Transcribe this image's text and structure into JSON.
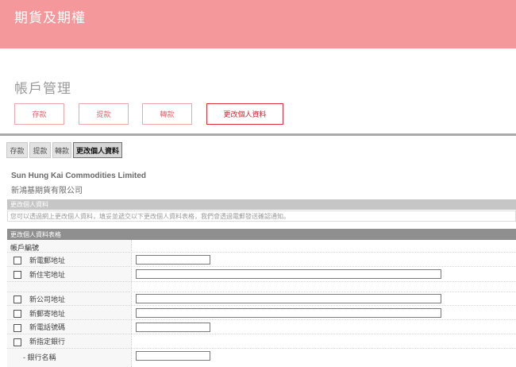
{
  "header": {
    "title": "期貨及期權"
  },
  "section": {
    "title": "帳戶管理"
  },
  "actions": {
    "deposit": "存款",
    "withdraw": "提款",
    "transfer": "轉款",
    "update_info": "更改個人資料"
  },
  "tabs": [
    "存款",
    "提款",
    "轉款",
    "更改個人資料"
  ],
  "company": {
    "name_en": "Sun Hung Kai Commodities Limited",
    "name_zh": "新鴻基期貨有限公司"
  },
  "info_band": {
    "title": "更改個人資料",
    "note": "您可以透過網上更改個人資料，填妥並遞交以下更改個人資料表格，我們會透過電郵發送確認通知。"
  },
  "form": {
    "title": "更改個人資料表格",
    "account_label": "帳戶編號",
    "fields": {
      "email": "新電郵地址",
      "home_address": "新住宅地址",
      "office_address": "新公司地址",
      "mailing_address": "新郵寄地址",
      "phone": "新電話號碼",
      "bank": "新指定銀行",
      "bank_name": "- 銀行名稱"
    }
  },
  "colors": {
    "header_bg": "#f4989c",
    "accent_border": "#f1a5a9",
    "active_border": "#e0303a"
  }
}
